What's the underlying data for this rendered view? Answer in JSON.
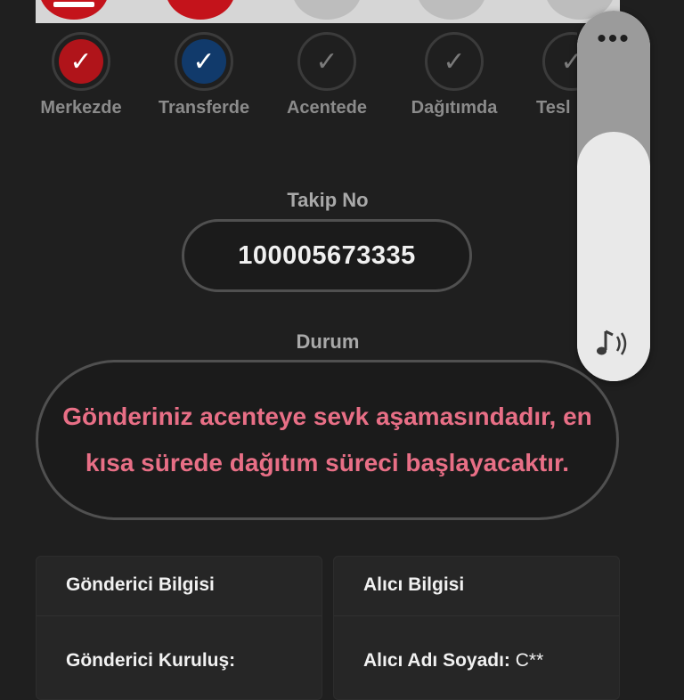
{
  "colors": {
    "background": "#1f1f1f",
    "accent_red": "#b0141a",
    "accent_blue": "#113a6b",
    "status_text": "#e86f86"
  },
  "steps": [
    {
      "label": "Merkezde",
      "state": "done",
      "color": "red"
    },
    {
      "label": "Transferde",
      "state": "done",
      "color": "blue"
    },
    {
      "label": "Acentede",
      "state": "pending"
    },
    {
      "label": "Dağıtımda",
      "state": "pending"
    },
    {
      "label": "Tesl",
      "state": "pending"
    }
  ],
  "check_glyph": "✓",
  "tracking": {
    "title": "Takip No",
    "number": "100005673335"
  },
  "status": {
    "title": "Durum",
    "message": "Gönderiniz acenteye sevk aşamasındadır, en kısa sürede dağıtım süreci başlayacaktır."
  },
  "sender": {
    "title": "Gönderici Bilgisi",
    "org_label": "Gönderici Kuruluş:",
    "org_value": ""
  },
  "receiver": {
    "title": "Alıcı Bilgisi",
    "name_label": "Alıcı Adı Soyadı:",
    "name_value": "C**"
  },
  "volume_panel": {
    "menu_label": "•••",
    "icon": "music-note-icon",
    "level": 0.67
  }
}
